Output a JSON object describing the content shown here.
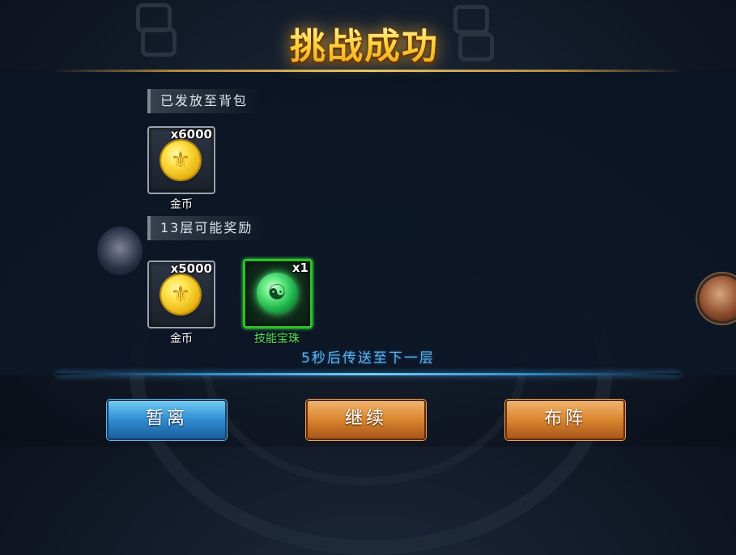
{
  "title": "挑战成功",
  "sections": {
    "delivered": {
      "label": "已发放至背包",
      "items": [
        {
          "name": "金币",
          "count": "x6000",
          "icon": "gold-coin-icon"
        }
      ]
    },
    "possible": {
      "label": "13层可能奖励",
      "items": [
        {
          "name": "金币",
          "count": "x5000",
          "icon": "gold-coin-icon"
        },
        {
          "name": "技能宝珠",
          "count": "x1",
          "icon": "skill-orb-icon"
        }
      ]
    }
  },
  "countdown_text": "5秒后传送至下一层",
  "buttons": {
    "leave": "暂离",
    "continue": "继续",
    "formation": "布阵"
  },
  "colors": {
    "title_gold": "#ffd13a",
    "blue_button": "#2f8cd0",
    "orange_button": "#d9852f",
    "rare_green": "#5be35a",
    "countdown_blue": "#5fb6ef"
  }
}
